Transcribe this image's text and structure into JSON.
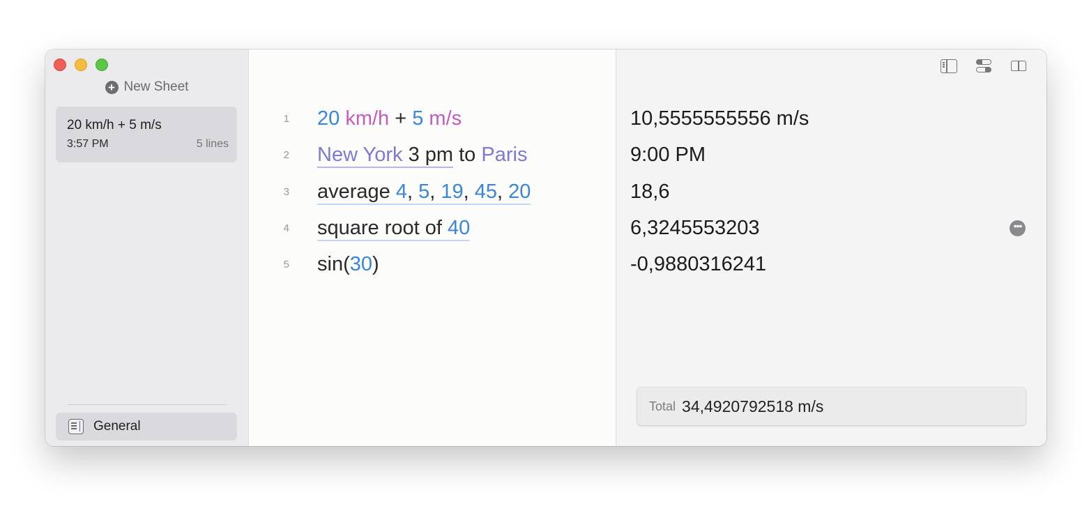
{
  "sidebar": {
    "new_sheet_label": "New Sheet",
    "sheets": [
      {
        "title": "20 km/h + 5 m/s",
        "time": "3:57 PM",
        "lines": "5 lines"
      }
    ],
    "group_label": "General"
  },
  "editor": {
    "lines": [
      {
        "number": "1",
        "tokens": [
          {
            "text": "20",
            "kind": "num"
          },
          {
            "text": " km/h",
            "kind": "unit"
          },
          {
            "text": " + ",
            "kind": "plain"
          },
          {
            "text": "5",
            "kind": "num"
          },
          {
            "text": " m/s",
            "kind": "unit"
          }
        ]
      },
      {
        "number": "2",
        "tokens": [
          {
            "text": "New York ",
            "kind": "place",
            "underline": "purple"
          },
          {
            "text": "3 pm",
            "kind": "plain",
            "underline": "purple"
          },
          {
            "text": " to ",
            "kind": "plain"
          },
          {
            "text": "Paris",
            "kind": "place"
          }
        ]
      },
      {
        "number": "3",
        "tokens": [
          {
            "text": "average ",
            "kind": "plain",
            "underline": "blue"
          },
          {
            "text": "4",
            "kind": "num",
            "underline": "blue"
          },
          {
            "text": ", ",
            "kind": "plain",
            "underline": "blue"
          },
          {
            "text": "5",
            "kind": "num",
            "underline": "blue"
          },
          {
            "text": ", ",
            "kind": "plain",
            "underline": "blue"
          },
          {
            "text": "19",
            "kind": "num",
            "underline": "blue"
          },
          {
            "text": ", ",
            "kind": "plain",
            "underline": "blue"
          },
          {
            "text": "45",
            "kind": "num",
            "underline": "blue"
          },
          {
            "text": ", ",
            "kind": "plain",
            "underline": "blue"
          },
          {
            "text": "20",
            "kind": "num",
            "underline": "blue"
          }
        ]
      },
      {
        "number": "4",
        "tokens": [
          {
            "text": "square root of ",
            "kind": "plain",
            "underline": "blue"
          },
          {
            "text": "40",
            "kind": "num",
            "underline": "blue"
          }
        ]
      },
      {
        "number": "5",
        "tokens": [
          {
            "text": "sin(",
            "kind": "plain"
          },
          {
            "text": "30",
            "kind": "num"
          },
          {
            "text": ")",
            "kind": "plain"
          }
        ]
      }
    ]
  },
  "results": {
    "values": [
      "10,5555555556 m/s",
      "9:00 PM",
      "18,6",
      "6,3245553203",
      "-0,9880316241"
    ],
    "more_icon_glyph": "•••",
    "total_label": "Total",
    "total_value": "34,4920792518 m/s"
  },
  "colors": {
    "number": "#3a86d8",
    "unit": "#c35dbd",
    "place": "#7e7ad3"
  }
}
